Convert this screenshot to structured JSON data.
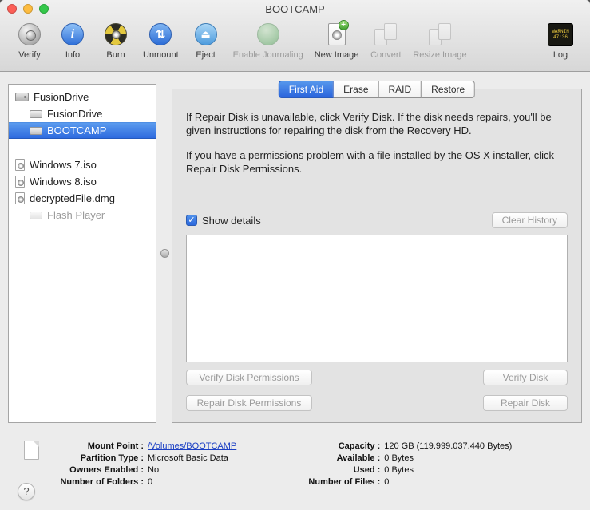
{
  "window": {
    "title": "BOOTCAMP"
  },
  "toolbar": {
    "items": [
      {
        "label": "Verify",
        "enabled": true
      },
      {
        "label": "Info",
        "enabled": true
      },
      {
        "label": "Burn",
        "enabled": true
      },
      {
        "label": "Unmount",
        "enabled": true
      },
      {
        "label": "Eject",
        "enabled": true
      },
      {
        "label": "Enable Journaling",
        "enabled": false
      },
      {
        "label": "New Image",
        "enabled": true
      },
      {
        "label": "Convert",
        "enabled": false
      },
      {
        "label": "Resize Image",
        "enabled": false
      }
    ],
    "log": {
      "label": "Log",
      "icon_lines": [
        "WARNIN",
        "47:36"
      ]
    }
  },
  "glyphs": {
    "info": "i",
    "unmount": "⇅",
    "eject": "⏏",
    "plus": "+",
    "check": "✓",
    "help": "?"
  },
  "sidebar": {
    "items": [
      {
        "label": "FusionDrive"
      },
      {
        "label": "FusionDrive"
      },
      {
        "label": "BOOTCAMP"
      },
      {
        "label": "Windows 7.iso"
      },
      {
        "label": "Windows 8.iso"
      },
      {
        "label": "decryptedFile.dmg"
      },
      {
        "label": "Flash Player"
      }
    ]
  },
  "tabs": [
    {
      "label": "First Aid",
      "selected": true
    },
    {
      "label": "Erase",
      "selected": false
    },
    {
      "label": "RAID",
      "selected": false
    },
    {
      "label": "Restore",
      "selected": false
    }
  ],
  "first_aid": {
    "para1": "If Repair Disk is unavailable, click Verify Disk. If the disk needs repairs, you'll be given instructions for repairing the disk from the Recovery HD.",
    "para2": "If you have a permissions problem with a file installed by the OS X installer, click Repair Disk Permissions.",
    "show_details_label": "Show details",
    "show_details_checked": true,
    "clear_history_label": "Clear History",
    "buttons": {
      "verify_permissions": "Verify Disk Permissions",
      "verify_disk": "Verify Disk",
      "repair_permissions": "Repair Disk Permissions",
      "repair_disk": "Repair Disk"
    }
  },
  "info": {
    "left": [
      {
        "label": "Mount Point :",
        "value": "/Volumes/BOOTCAMP"
      },
      {
        "label": "Partition Type :",
        "value": "Microsoft Basic Data"
      },
      {
        "label": "Owners Enabled :",
        "value": "No"
      },
      {
        "label": "Number of Folders :",
        "value": "0"
      }
    ],
    "right": [
      {
        "label": "Capacity :",
        "value": "120 GB (119.999.037.440 Bytes)"
      },
      {
        "label": "Available :",
        "value": "0 Bytes"
      },
      {
        "label": "Used :",
        "value": "0 Bytes"
      },
      {
        "label": "Number of Files :",
        "value": "0"
      }
    ]
  }
}
